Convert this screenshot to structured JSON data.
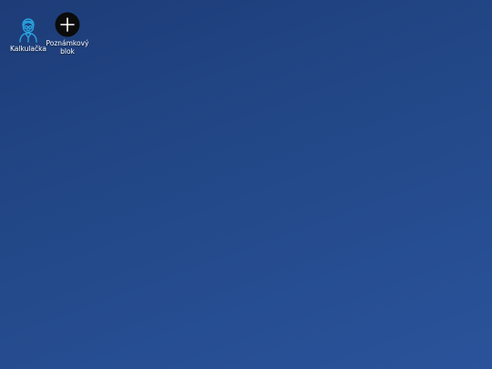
{
  "desktop": {
    "icons": [
      {
        "label": "Kalkulačka",
        "icon": "person-avatar-icon"
      },
      {
        "label": "Poznámkový blok",
        "icon": "plus-circle-icon"
      }
    ]
  },
  "colors": {
    "background_top": "#1d3c78",
    "background_bottom": "#2a539b",
    "calc_icon_stroke": "#29a3e0",
    "notes_icon_fill": "#0b0b0b"
  }
}
